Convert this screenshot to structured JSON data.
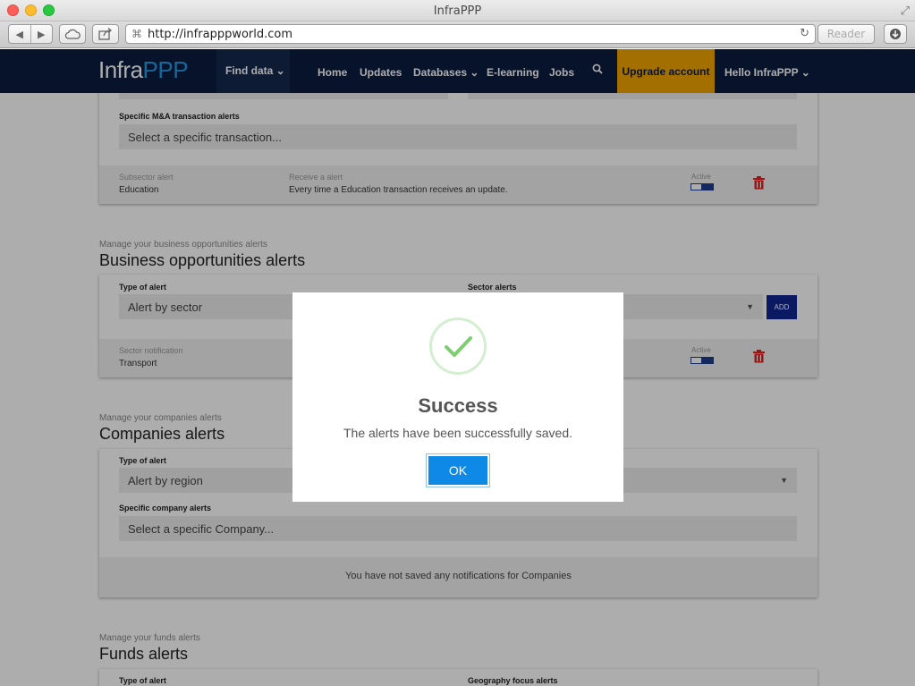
{
  "browser": {
    "window_title": "InfraPPP",
    "url": "http://infrapppworld.com",
    "reader_label": "Reader"
  },
  "site": {
    "logo_infra": "Infra",
    "logo_ppp": "PPP",
    "find_data": "Find data ⌄",
    "nav": {
      "home": "Home",
      "updates": "Updates",
      "databases": "Databases ⌄",
      "elearning": "E-learning",
      "jobs": "Jobs"
    },
    "upgrade": "Upgrade account",
    "user": "Hello InfraPPP ⌄"
  },
  "ma_section": {
    "specific_label": "Specific M&A transaction alerts",
    "specific_placeholder": "Select a specific transaction...",
    "row": {
      "col1_label": "Subsector alert",
      "col1_value": "Education",
      "col2_label": "Receive a alert",
      "col2_value": "Every time a Education transaction receives an update.",
      "active_label": "Active"
    }
  },
  "business_section": {
    "subtitle": "Manage your business opportunities alerts",
    "title": "Business opportunities alerts",
    "type_label": "Type of alert",
    "type_value": "Alert by sector",
    "sector_label": "Sector alerts",
    "add_label": "ADD",
    "row": {
      "col1_label": "Sector notification",
      "col1_value": "Transport",
      "active_label": "Active"
    }
  },
  "companies_section": {
    "subtitle": "Manage your companies alerts",
    "title": "Companies alerts",
    "type_label": "Type of alert",
    "type_value": "Alert by region",
    "specific_label": "Specific company alerts",
    "specific_placeholder": "Select a specific Company...",
    "empty_message": "You have not saved any notifications for Companies"
  },
  "funds_section": {
    "subtitle": "Manage your funds alerts",
    "title": "Funds alerts",
    "type_label": "Type of alert",
    "geo_label": "Geography focus alerts"
  },
  "dialog": {
    "title": "Success",
    "message": "The alerts have been successfully saved.",
    "ok_label": "OK"
  },
  "colors": {
    "nav_bg": "#0b1c3f",
    "accent_blue": "#1d9be6",
    "upgrade_bg": "#f0a500",
    "ok_button": "#0e8ae6",
    "success_green": "#7ccf6e",
    "trash_red": "#e02121"
  }
}
